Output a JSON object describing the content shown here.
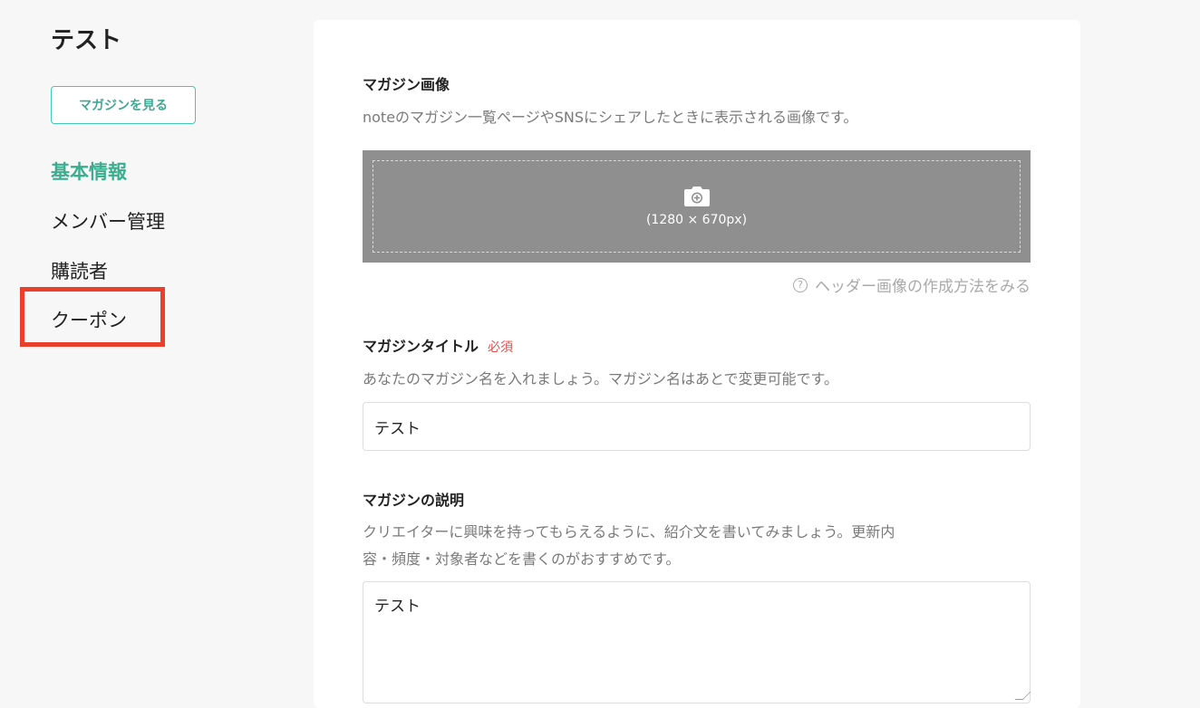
{
  "sidebar": {
    "magazine_title": "テスト",
    "view_button": "マガジンを見る",
    "nav": [
      {
        "label": "基本情報",
        "active": true
      },
      {
        "label": "メンバー管理",
        "active": false
      },
      {
        "label": "購読者",
        "active": false
      },
      {
        "label": "クーポン",
        "active": false,
        "highlighted": true
      }
    ]
  },
  "image_section": {
    "label": "マガジン画像",
    "description": "noteのマガジン一覧ページやSNSにシェアしたときに表示される画像です。",
    "size_hint": "(1280 × 670px)",
    "help_link": "ヘッダー画像の作成方法をみる",
    "icon": "camera-add-icon"
  },
  "title_section": {
    "label": "マガジンタイトル",
    "required": "必須",
    "description": "あなたのマガジン名を入れましょう。マガジン名はあとで変更可能です。",
    "value": "テスト"
  },
  "description_section": {
    "label": "マガジンの説明",
    "description_line1": "クリエイターに興味を持ってもらえるように、紹介文を書いてみましょう。更新内",
    "description_line2": "容・頻度・対象者などを書くのがおすすめです。",
    "value": "テスト"
  },
  "colors": {
    "accent": "#41c9b4",
    "highlight_box": "#e8402a",
    "required": "#e0504a"
  }
}
